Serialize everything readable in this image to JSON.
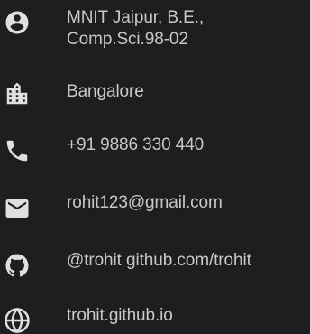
{
  "colors": {
    "background": "#1e1e20",
    "text": "#c9c9cc",
    "icon": "#e0e0e2"
  },
  "contact": {
    "education": {
      "icon": "account-circle-icon",
      "line1": "MNIT Jaipur, B.E.,",
      "line2": "Comp.Sci.98-02"
    },
    "location": {
      "icon": "city-icon",
      "text": "Bangalore"
    },
    "phone": {
      "icon": "phone-icon",
      "text": "+91 9886 330 440"
    },
    "email": {
      "icon": "email-icon",
      "text": "rohit123@gmail.com"
    },
    "github": {
      "icon": "github-icon",
      "text": "@trohit github.com/trohit"
    },
    "website": {
      "icon": "globe-icon",
      "text": "trohit.github.io"
    }
  }
}
